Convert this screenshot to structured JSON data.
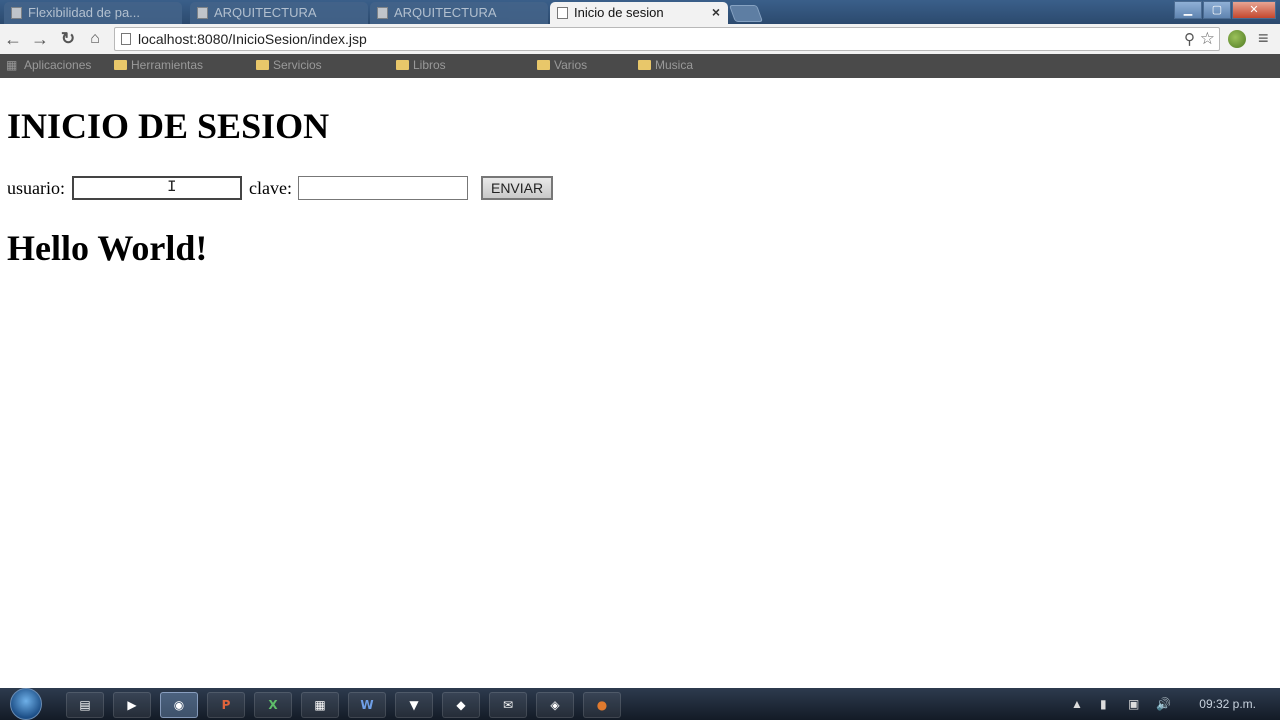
{
  "browser": {
    "tabs": [
      {
        "label": "Flexibilidad de pa...",
        "active": false
      },
      {
        "label": "ARQUITECTURA",
        "active": false
      },
      {
        "label": "ARQUITECTURA",
        "active": false
      },
      {
        "label": "Inicio de sesion",
        "active": true
      }
    ],
    "url": "localhost:8080/InicioSesion/index.jsp",
    "bookmarks": [
      "Aplicaciones",
      "Herramientas",
      "Servicios",
      "Libros",
      "Varios",
      "Musica"
    ]
  },
  "page": {
    "heading": "INICIO DE SESION",
    "usuario_label": "usuario:",
    "usuario_value": "",
    "clave_label": "clave:",
    "clave_value": "",
    "submit_label": "ENVIAR",
    "hello": "Hello World!"
  },
  "taskbar": {
    "apps": [
      "explorer",
      "media-player",
      "chrome",
      "powerpoint",
      "excel",
      "calculator",
      "word",
      "app",
      "tool",
      "email",
      "network",
      "netbeans"
    ],
    "clock": "09:32 p.m."
  }
}
